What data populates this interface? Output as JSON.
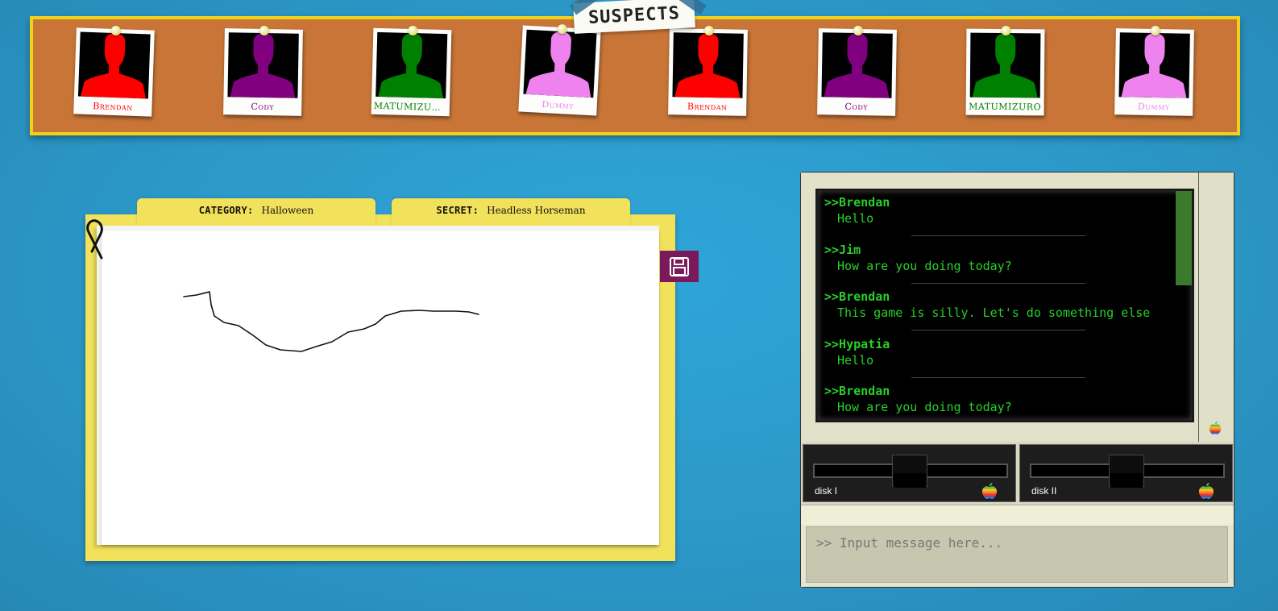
{
  "board": {
    "title": "SUSPECTS",
    "suspects": [
      {
        "name": "Brendan",
        "color": "#ff0000"
      },
      {
        "name": "Cody",
        "color": "#800080"
      },
      {
        "name": "MATUMIZURO...",
        "color": "#008000"
      },
      {
        "name": "Dummy",
        "color": "#ee82ee"
      },
      {
        "name": "Brendan",
        "color": "#ff0000"
      },
      {
        "name": "Cody",
        "color": "#800080"
      },
      {
        "name": "MATUMIZURO",
        "color": "#008000"
      },
      {
        "name": "Dummy",
        "color": "#ee82ee"
      }
    ]
  },
  "folder": {
    "category_label": "CATEGORY:",
    "category_value": "Halloween",
    "secret_label": "SECRET:",
    "secret_value": "Headless Horseman",
    "save_icon": "floppy-disk-icon"
  },
  "chat": {
    "messages": [
      {
        "author": ">>Brendan",
        "text": "Hello"
      },
      {
        "author": ">>Jim",
        "text": "How are you doing today?"
      },
      {
        "author": ">>Brendan",
        "text": "This game is silly. Let's do something else"
      },
      {
        "author": ">>Hypatia",
        "text": "Hello"
      },
      {
        "author": ">>Brendan",
        "text": "How are you doing today?"
      }
    ],
    "text_color": "#27cf2b"
  },
  "drives": [
    {
      "label": "disk I"
    },
    {
      "label": "disk II"
    }
  ],
  "input": {
    "placeholder": ">> Input message here..."
  }
}
